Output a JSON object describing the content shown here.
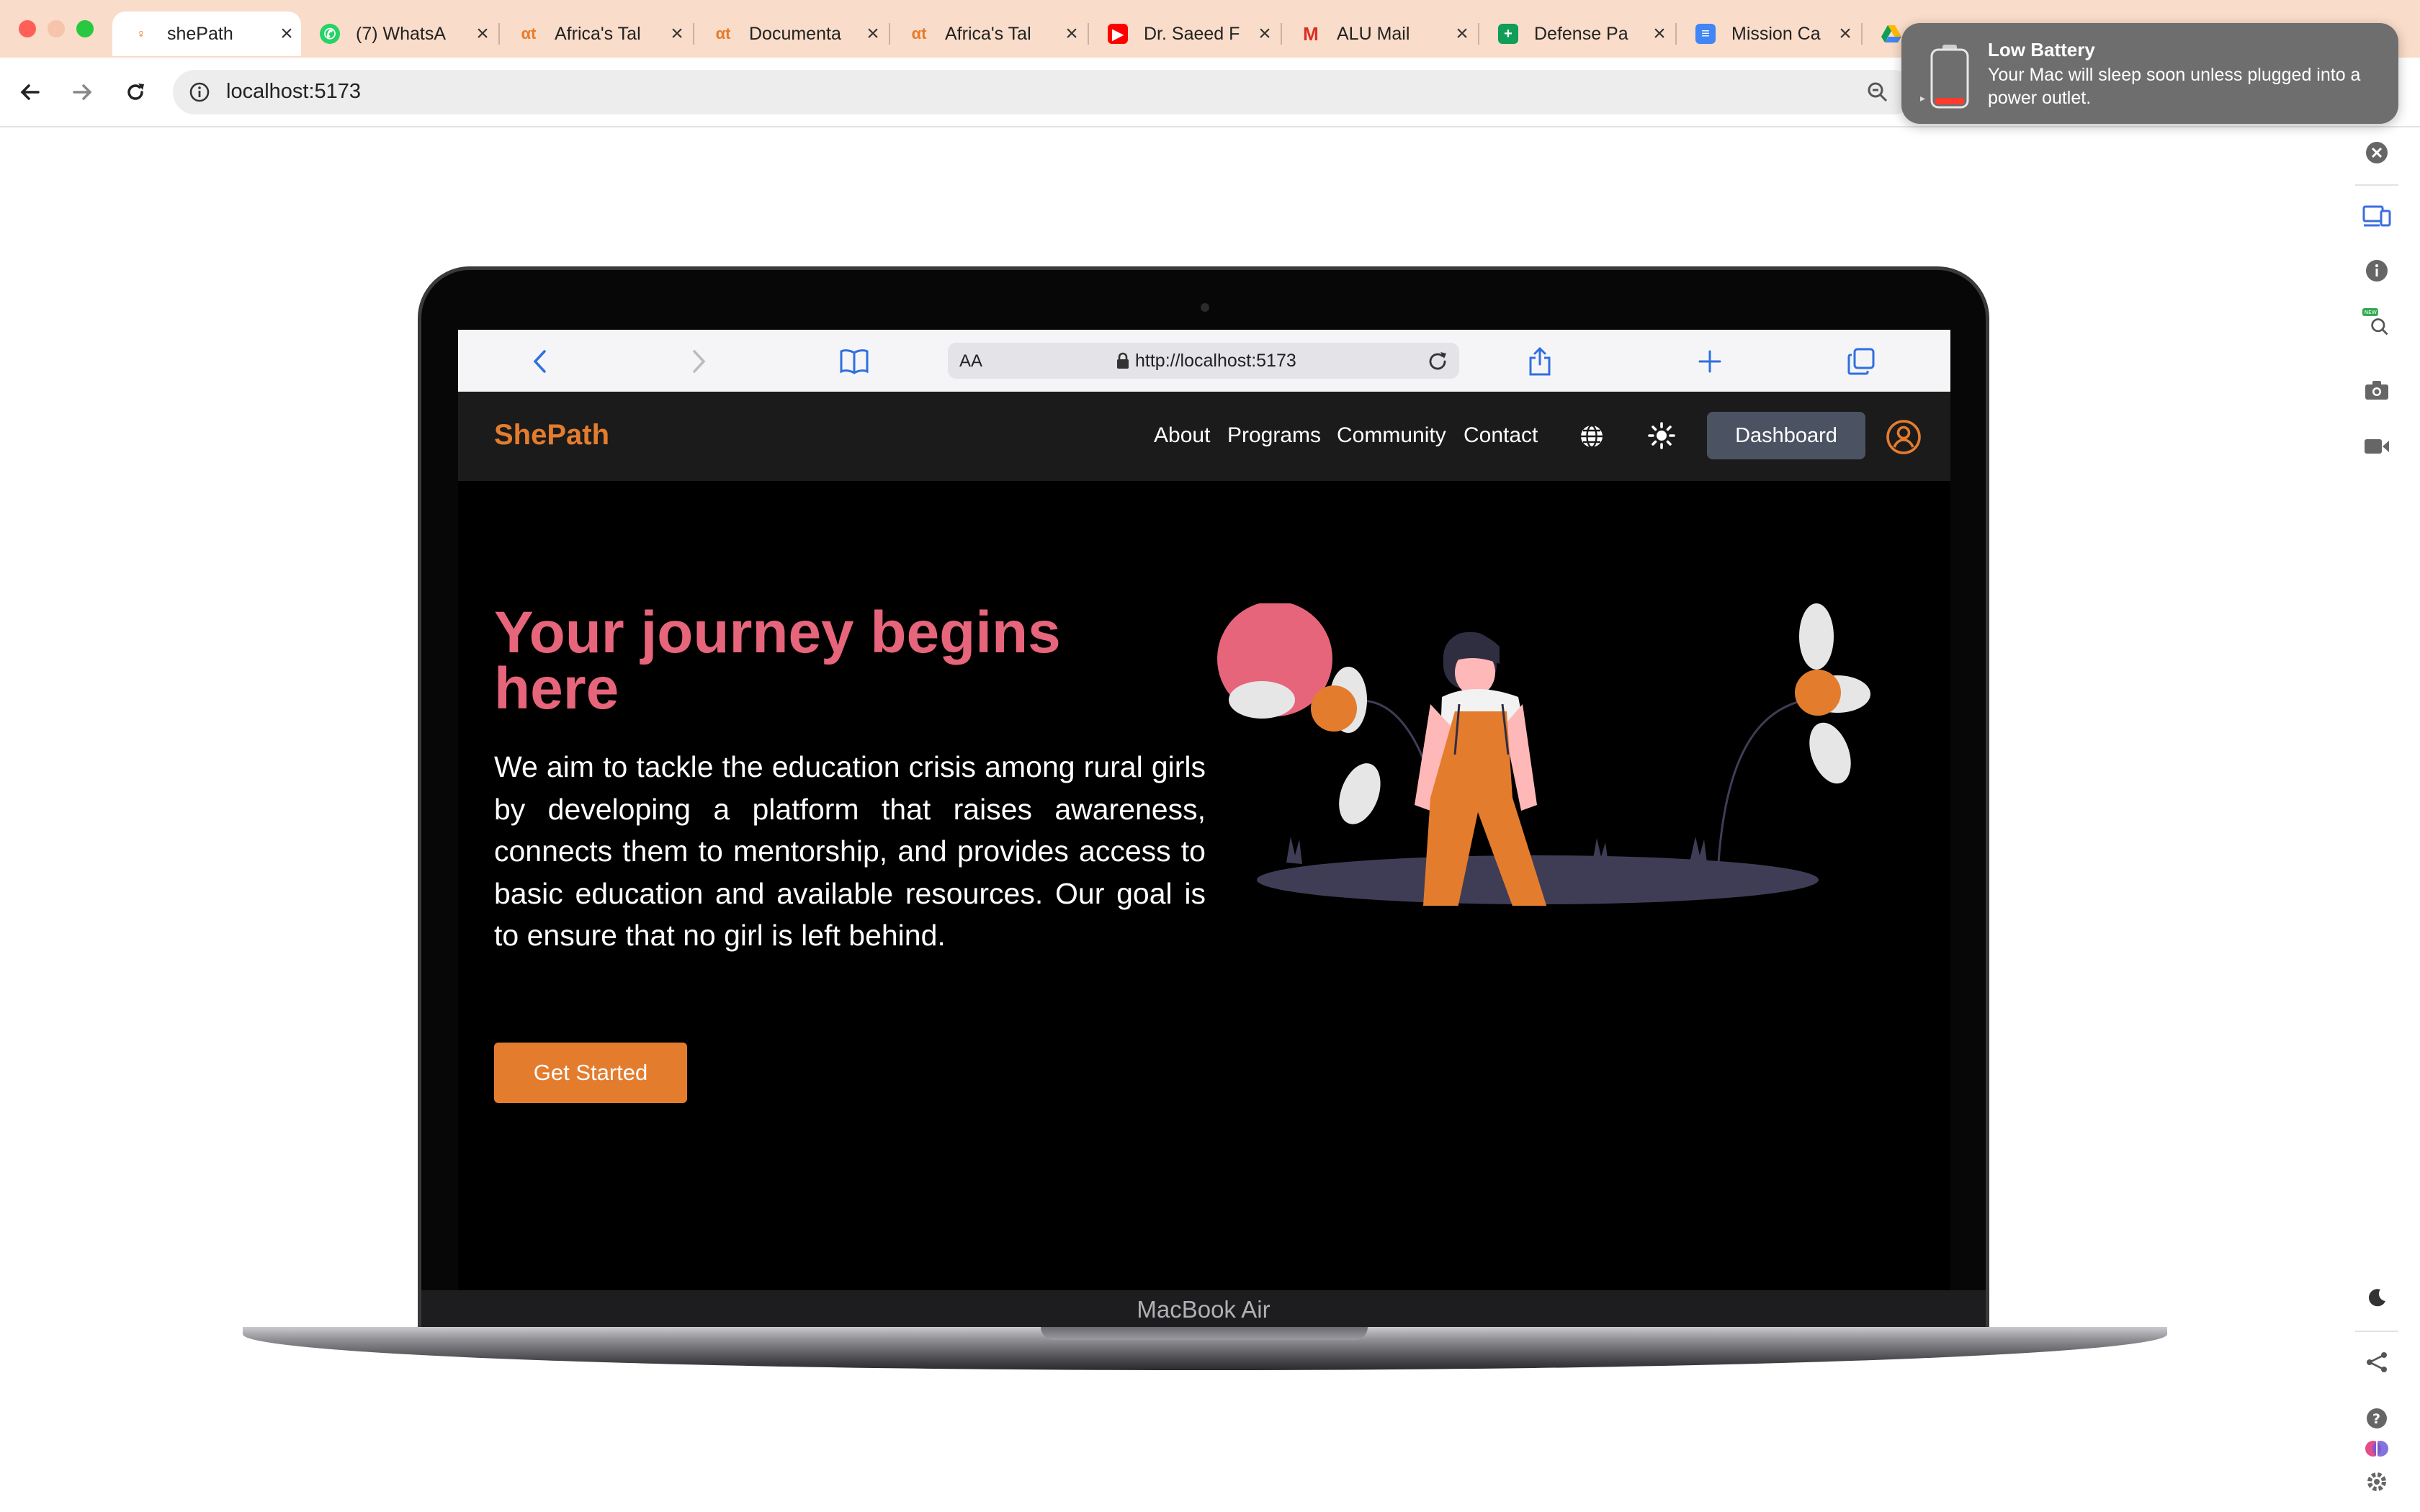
{
  "chrome": {
    "tabs": [
      {
        "label": "shePath",
        "icon": "shepath-favicon",
        "active": true
      },
      {
        "label": "(7) WhatsA",
        "icon": "whatsapp-icon"
      },
      {
        "label": "Africa's Tal",
        "icon": "africastalking-icon"
      },
      {
        "label": "Documenta",
        "icon": "africastalking-icon"
      },
      {
        "label": "Africa's Tal",
        "icon": "africastalking-icon"
      },
      {
        "label": "Dr. Saeed F",
        "icon": "youtube-icon"
      },
      {
        "label": "ALU Mail",
        "icon": "gmail-icon"
      },
      {
        "label": "Defense Pa",
        "icon": "google-sheets-icon"
      },
      {
        "label": "Mission Ca",
        "icon": "google-docs-icon"
      },
      {
        "label": "",
        "icon": "google-drive-icon"
      }
    ],
    "address": "localhost:5173"
  },
  "notification": {
    "title": "Low Battery",
    "body": "Your Mac will sleep soon unless plugged into a power outlet."
  },
  "device": {
    "label": "MacBook Air"
  },
  "safari": {
    "aa_label": "AA",
    "url": "http://localhost:5173"
  },
  "site": {
    "brand": "ShePath",
    "nav": [
      "About",
      "Programs",
      "Community",
      "Contact"
    ],
    "dashboard_label": "Dashboard",
    "hero_title": "Your journey begins here",
    "hero_text": "We aim to tackle the education crisis among rural girls by developing a platform that raises awareness, connects them to mentorship, and provides access to basic education and available resources. Our goal is to ensure that no girl is left behind.",
    "cta_label": "Get Started"
  },
  "colors": {
    "accent_orange": "#e47c2e",
    "hero_pink": "#e7657b",
    "tabbar": "#f9dcc9",
    "dashboard_button": "#4b5262"
  }
}
